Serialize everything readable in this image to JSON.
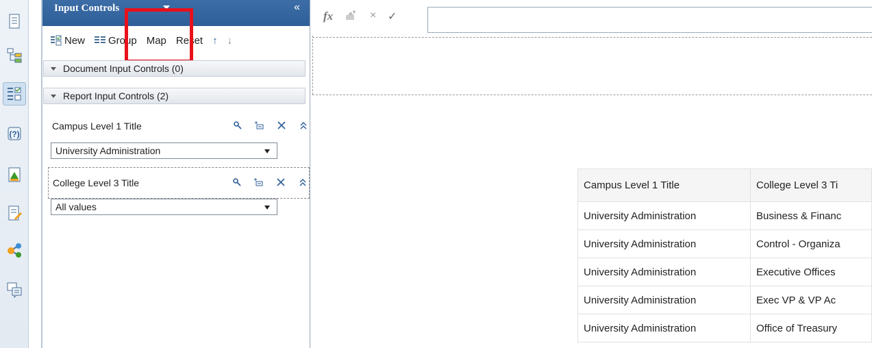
{
  "panel": {
    "title": "Input Controls",
    "collapse_glyph": "«"
  },
  "toolbar": {
    "new_label": "New",
    "group_label": "Group",
    "map_label": "Map",
    "reset_label": "Reset",
    "up_glyph": "↑",
    "down_glyph": "↓"
  },
  "sections": {
    "document": "Document Input Controls (0)",
    "report": "Report Input Controls (2)"
  },
  "controls": [
    {
      "title": "Campus Level 1 Title",
      "value": "University Administration"
    },
    {
      "title": "College Level 3 Title",
      "value": "All values"
    }
  ],
  "formula": {
    "fx_label": "fx",
    "cancel_glyph": "×",
    "accept_glyph": "✓"
  },
  "table": {
    "headers": [
      "Campus Level 1 Title",
      "College Level 3 Ti"
    ],
    "rows": [
      [
        "University Administration",
        "Business & Financ"
      ],
      [
        "University Administration",
        "Control - Organiza"
      ],
      [
        "University Administration",
        "Executive Offices"
      ],
      [
        "University Administration",
        "Exec VP & VP Ac"
      ],
      [
        "University Administration",
        "Office of Treasury"
      ]
    ]
  },
  "colors": {
    "header_blue": "#2f5f98",
    "highlight_red": "#e8111b"
  }
}
